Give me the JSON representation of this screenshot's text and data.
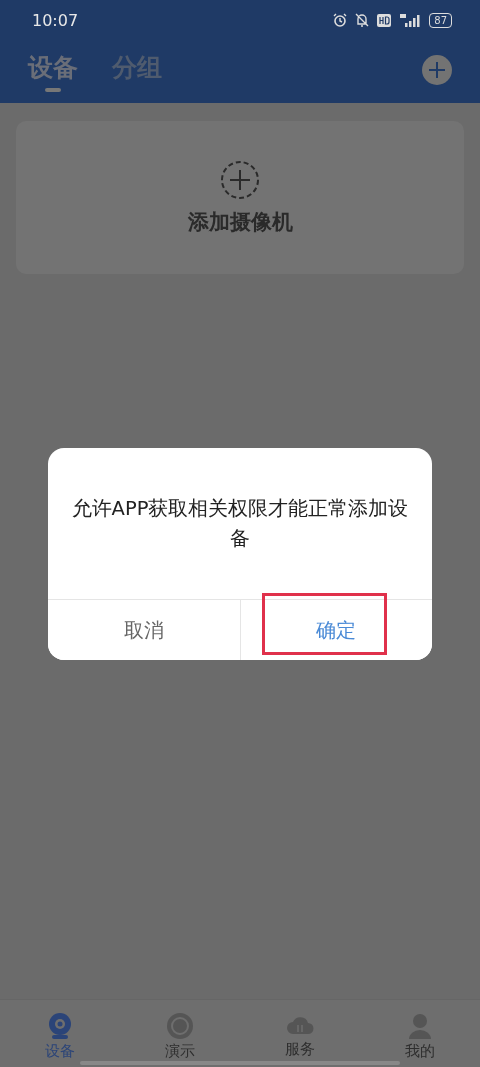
{
  "status_bar": {
    "time": "10:07",
    "battery": "87"
  },
  "tabs": [
    {
      "label": "设备",
      "selected": true
    },
    {
      "label": "分组",
      "selected": false
    }
  ],
  "add_camera_card": {
    "label": "添加摄像机"
  },
  "dialog": {
    "message": "允许APP获取相关权限才能正常添加设备",
    "buttons": [
      {
        "label": "取消",
        "kind": "cancel",
        "highlighted": false
      },
      {
        "label": "确定",
        "kind": "confirm",
        "highlighted": true
      }
    ]
  },
  "bottom_nav": [
    {
      "label": "设备",
      "kind": "camera",
      "selected": true
    },
    {
      "label": "演示",
      "kind": "disc",
      "selected": false
    },
    {
      "label": "服务",
      "kind": "cloud",
      "selected": false
    },
    {
      "label": "我的",
      "kind": "person",
      "selected": false
    }
  ]
}
